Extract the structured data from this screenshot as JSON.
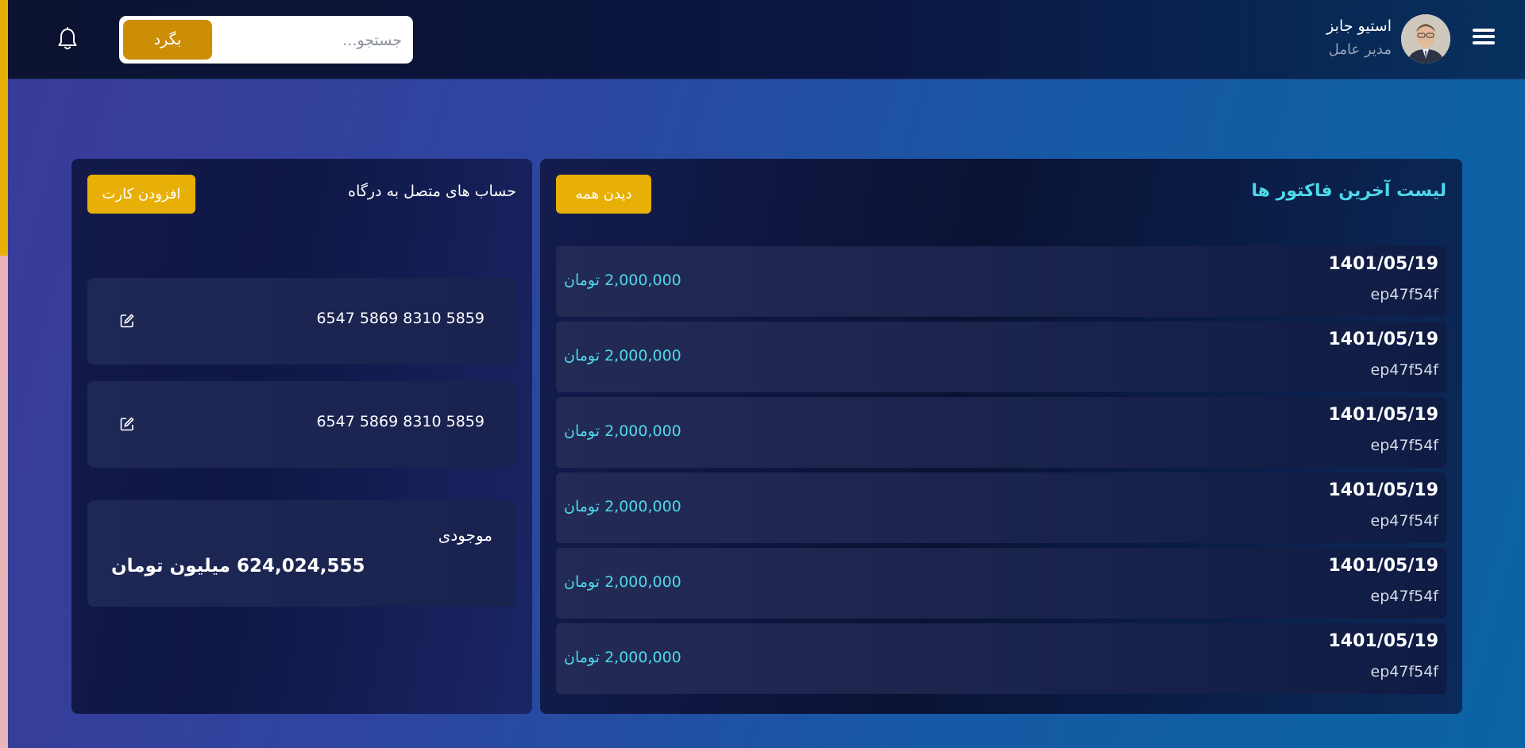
{
  "header": {
    "user": {
      "name": "استیو جابز",
      "role": "مدیر عامل"
    },
    "search": {
      "placeholder": "جستجو...",
      "button_label": "بگرد"
    }
  },
  "accounts": {
    "title": "حساب های متصل به درگاه",
    "add_button_label": "افزودن کارت",
    "cards": [
      {
        "number": "6547 5869 8310 5859"
      },
      {
        "number": "6547 5869 8310 5859"
      }
    ],
    "balance": {
      "label": "موجودی",
      "value": "624,024,555 میلیون تومان"
    }
  },
  "invoices": {
    "title": "لیست آخرین فاکتور ها",
    "see_all_label": "دیدن همه",
    "items": [
      {
        "date": "1401/05/19",
        "code": "ep47f54f",
        "amount": "2,000,000 تومان"
      },
      {
        "date": "1401/05/19",
        "code": "ep47f54f",
        "amount": "2,000,000 تومان"
      },
      {
        "date": "1401/05/19",
        "code": "ep47f54f",
        "amount": "2,000,000 تومان"
      },
      {
        "date": "1401/05/19",
        "code": "ep47f54f",
        "amount": "2,000,000 تومان"
      },
      {
        "date": "1401/05/19",
        "code": "ep47f54f",
        "amount": "2,000,000 تومان"
      },
      {
        "date": "1401/05/19",
        "code": "ep47f54f",
        "amount": "2,000,000 تومان"
      }
    ]
  },
  "icons": {
    "menu": "hamburger-menu-icon",
    "notification": "bell-icon",
    "edit": "edit-icon"
  },
  "colors": {
    "accent_yellow": "#e8b007",
    "search_button": "#cc8d07",
    "cyan_text": "#4fd8ea",
    "topbar_bg": "#0b1330"
  }
}
